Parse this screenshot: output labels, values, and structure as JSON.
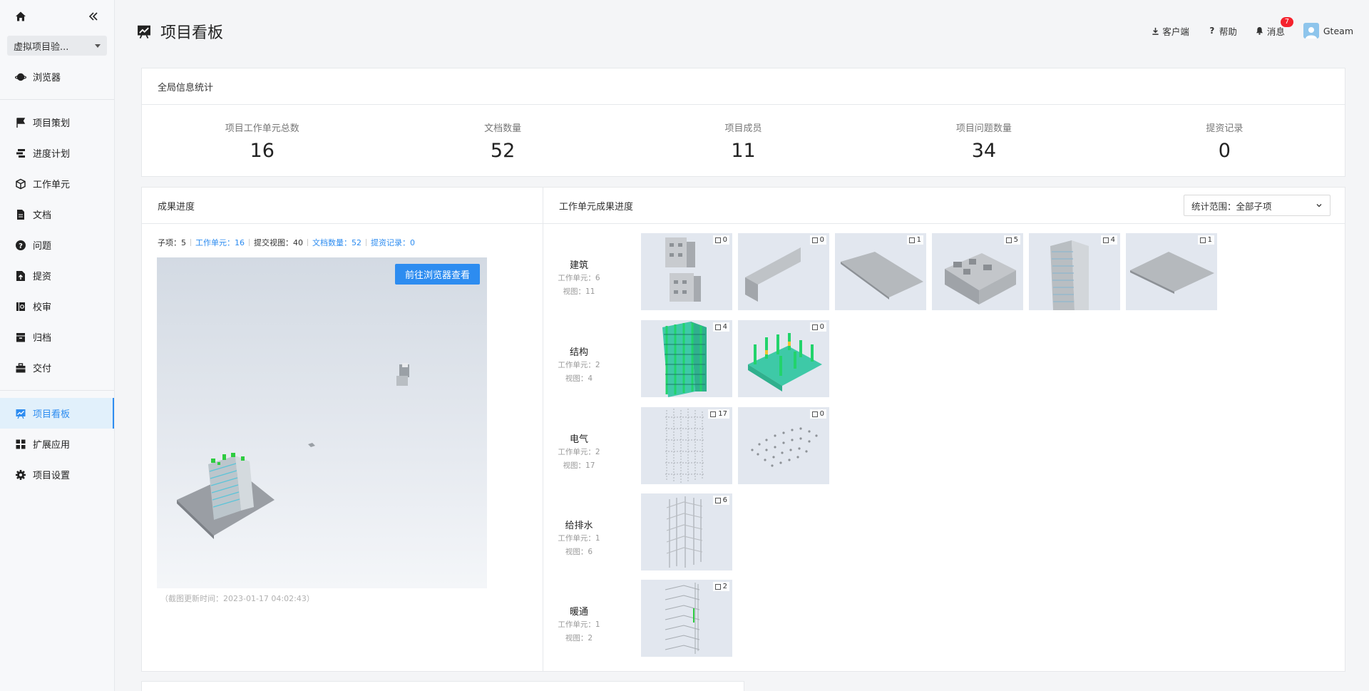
{
  "sidebar": {
    "project": "虚拟项目验...",
    "browser": "浏览器",
    "group1": [
      "项目策划",
      "进度计划",
      "工作单元",
      "文档",
      "问题",
      "提资",
      "校审",
      "归档",
      "交付"
    ],
    "group2": [
      "项目看板",
      "扩展应用",
      "项目设置"
    ]
  },
  "header": {
    "title": "项目看板",
    "client": "客户端",
    "help": "帮助",
    "messages": "消息",
    "messages_badge": "7",
    "user": "Gteam"
  },
  "stats": {
    "title": "全局信息统计",
    "items": [
      {
        "label": "项目工作单元总数",
        "value": "16"
      },
      {
        "label": "文档数量",
        "value": "52"
      },
      {
        "label": "项目成员",
        "value": "11"
      },
      {
        "label": "项目问题数量",
        "value": "34"
      },
      {
        "label": "提资记录",
        "value": "0"
      }
    ]
  },
  "progress": {
    "title": "成果进度",
    "summary": {
      "subitems": "子项：5",
      "units": "工作单元：16",
      "views": "提交视图：40",
      "docs": "文档数量：52",
      "submits": "提资记录：0"
    },
    "open_button": "前往浏览器查看",
    "caption": "（截图更新时间：2023-01-17 04:02:43）"
  },
  "units": {
    "title": "工作单元成果进度",
    "scope": "统计范围：全部子项",
    "rows": [
      {
        "name": "建筑",
        "units": "工作单元：6",
        "views": "视图：11",
        "counts": [
          "0",
          "0",
          "1",
          "5",
          "4",
          "1"
        ]
      },
      {
        "name": "结构",
        "units": "工作单元：2",
        "views": "视图：4",
        "counts": [
          "4",
          "0"
        ]
      },
      {
        "name": "电气",
        "units": "工作单元：2",
        "views": "视图：17",
        "counts": [
          "17",
          "0"
        ]
      },
      {
        "name": "给排水",
        "units": "工作单元：1",
        "views": "视图：6",
        "counts": [
          "6"
        ]
      },
      {
        "name": "暖通",
        "units": "工作单元：1",
        "views": "视图：2",
        "counts": [
          "2"
        ]
      }
    ]
  },
  "colors": {
    "accent": "#2d8cf0",
    "badge": "#f5222d",
    "thumb_bg": "#e2e7ef"
  }
}
